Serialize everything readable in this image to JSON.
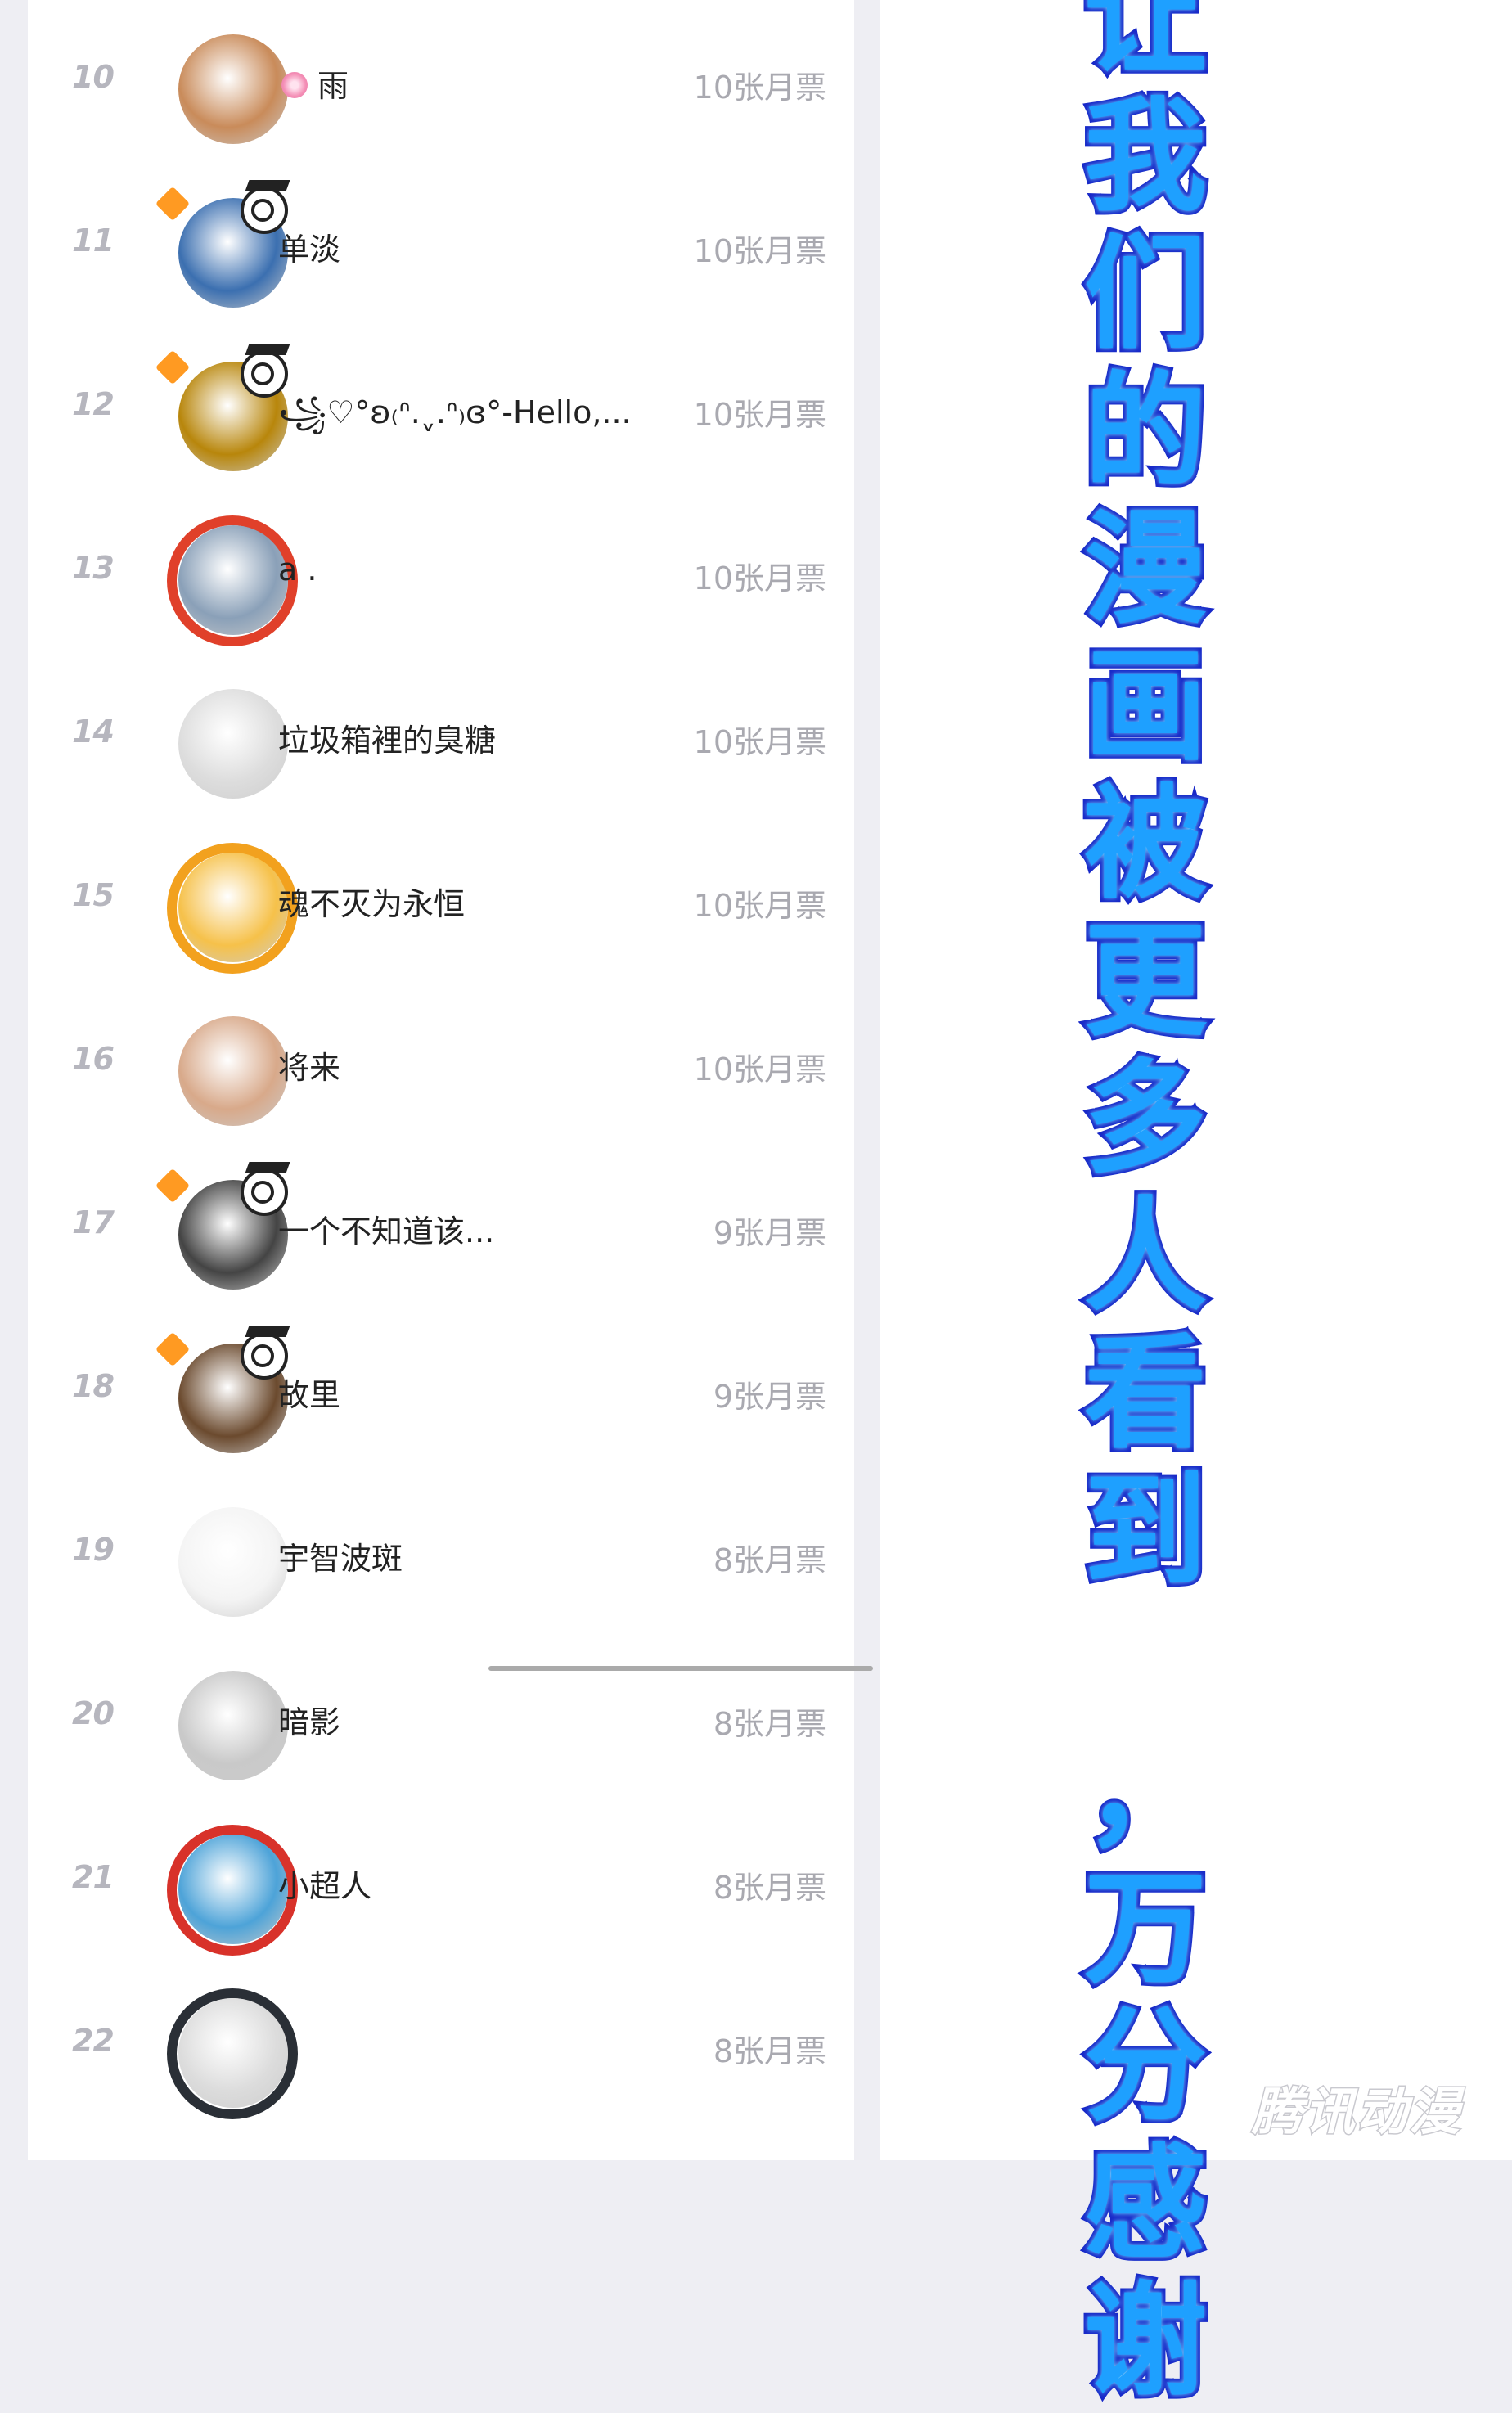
{
  "ranking": [
    {
      "rank": "10",
      "name": "雨",
      "votes": "10张月票",
      "avatar_color": "#c98b5a",
      "has_flower": true
    },
    {
      "rank": "11",
      "name": "单淡",
      "votes": "10张月票",
      "avatar_color": "#3b6fb0",
      "has_badge": true
    },
    {
      "rank": "12",
      "name": "꧁♡°ʚ₍ᐢ.ˬ.ᐢ₎ɞ°-Hello,...",
      "votes": "10张月票",
      "avatar_color": "#b8860b",
      "has_badge": true
    },
    {
      "rank": "13",
      "name": "a .",
      "votes": "10张月票",
      "avatar_color": "#8aa0b8",
      "has_frame": true,
      "frame_color": "#e0402a"
    },
    {
      "rank": "14",
      "name": "垃圾箱裡的臭糖",
      "votes": "10张月票",
      "avatar_color": "#dddddd"
    },
    {
      "rank": "15",
      "name": "魂不灭为永恒",
      "votes": "10张月票",
      "avatar_color": "#f6c14a",
      "has_frame": true,
      "frame_color": "#f2a11e"
    },
    {
      "rank": "16",
      "name": "将来",
      "votes": "10张月票",
      "avatar_color": "#d8a98a"
    },
    {
      "rank": "17",
      "name": "一个不知道该...",
      "votes": "9张月票",
      "avatar_color": "#444444",
      "has_badge": true
    },
    {
      "rank": "18",
      "name": "故里",
      "votes": "9张月票",
      "avatar_color": "#6b4a2e",
      "has_badge": true
    },
    {
      "rank": "19",
      "name": "宇智波斑",
      "votes": "8张月票",
      "avatar_color": "#f4f4f4"
    },
    {
      "rank": "20",
      "name": "暗影",
      "votes": "8张月票",
      "avatar_color": "#c9c9c9"
    },
    {
      "rank": "21",
      "name": "小超人",
      "votes": "8张月票",
      "avatar_color": "#4da3d8",
      "has_frame": true,
      "frame_color": "#d8322a"
    },
    {
      "rank": "22",
      "name": "",
      "votes": "8张月票",
      "avatar_color": "#dcdcdc",
      "has_frame": true,
      "frame_color": "#2a2f36"
    }
  ],
  "banner": {
    "chars_top": [
      "让",
      "我",
      "们",
      "的",
      "漫",
      "画",
      "被",
      "更",
      "多",
      "人",
      "看",
      "到"
    ],
    "chars_bottom": [
      "，",
      "万",
      "分",
      "感",
      "谢"
    ]
  },
  "watermark": "腾讯动漫",
  "colors": {
    "rank": "#b6b6be",
    "votes": "#a9a9b0",
    "banner_fill": "#1ea0ff",
    "banner_stroke": "#1828c8"
  }
}
